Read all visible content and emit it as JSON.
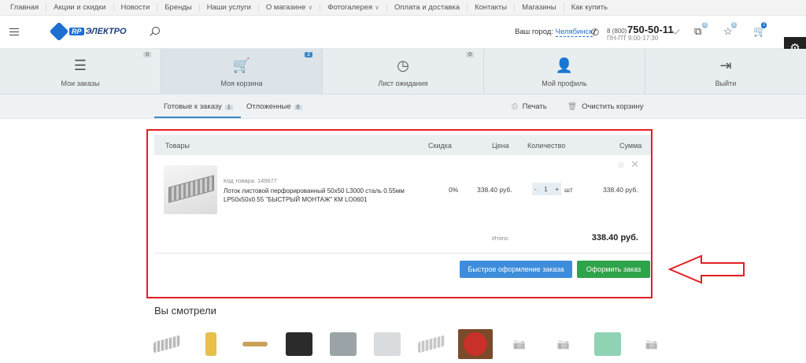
{
  "topnav": [
    {
      "label": "Главная",
      "arrow": false
    },
    {
      "label": "Акции и скидки",
      "arrow": false
    },
    {
      "label": "Новости",
      "arrow": false
    },
    {
      "label": "Бренды",
      "arrow": false
    },
    {
      "label": "Наши услуги",
      "arrow": false
    },
    {
      "label": "О магазине",
      "arrow": true
    },
    {
      "label": "Фотогалерея",
      "arrow": true
    },
    {
      "label": "Оплата и доставка",
      "arrow": false
    },
    {
      "label": "Контакты",
      "arrow": false
    },
    {
      "label": "Магазины",
      "arrow": false
    },
    {
      "label": "Как купить",
      "arrow": false
    }
  ],
  "header": {
    "logo_rp": "RP",
    "logo_text": "ЭЛЕКТРО",
    "city_label": "Ваш город:",
    "city_value": "Челябинск",
    "phone_prefix": "8 (800)",
    "phone_number": "750-50-11",
    "phone_hours": "ПН-ПТ 9:00-17:30",
    "compare_count": "0",
    "favorites_count": "0",
    "cart_count": "2"
  },
  "tabs": [
    {
      "label": "Мои заказы",
      "count": "0",
      "icon": "list-icon",
      "glyph": "☰"
    },
    {
      "label": "Моя корзина",
      "count": "2",
      "icon": "cart-icon",
      "glyph": "🛒"
    },
    {
      "label": "Лист ожидания",
      "count": "0",
      "icon": "clock-icon",
      "glyph": "◷"
    },
    {
      "label": "Мой профиль",
      "count": "",
      "icon": "user-icon",
      "glyph": "👤"
    },
    {
      "label": "Выйти",
      "count": "",
      "icon": "logout-icon",
      "glyph": "⇥"
    }
  ],
  "subtabs": {
    "ready_label": "Готовые к заказу",
    "ready_count": "1",
    "postponed_label": "Отложенные",
    "postponed_count": "0",
    "print_label": "Печать",
    "clear_label": "Очистить корзину"
  },
  "cart": {
    "columns": {
      "goods": "Товары",
      "discount": "Скидка",
      "price": "Цена",
      "quantity": "Количество",
      "sum": "Сумма"
    },
    "item": {
      "code": "Код товара: 149677",
      "name": "Лоток листовой перфорированный 50х50 L3000 сталь 0.55мм LP50x50x0.55 \"БЫСТРЫЙ МОНТАЖ\" КМ LO0601",
      "discount": "0%",
      "price": "338.40 руб.",
      "qty_minus": "-",
      "qty": "1",
      "qty_plus": "+",
      "unit": "шт",
      "sum": "338.40 руб."
    },
    "total_label": "Итого:",
    "total_value": "338.40 руб.",
    "quick_order_label": "Быстрое оформление заказа",
    "checkout_label": "Оформить заказ"
  },
  "seen": {
    "title": "Вы смотрели",
    "items": [
      {
        "kind": "tray",
        "color": "#b9b9b9"
      },
      {
        "kind": "bottle",
        "color": "#e7c04a"
      },
      {
        "kind": "pen",
        "color": "#c9a25a"
      },
      {
        "kind": "backpack",
        "color": "#2b2b2b"
      },
      {
        "kind": "box",
        "color": "#9aa3a8"
      },
      {
        "kind": "meter",
        "color": "#d8dcde"
      },
      {
        "kind": "tray",
        "color": "#c7c7c7"
      },
      {
        "kind": "santa",
        "color": "#c8302a"
      },
      {
        "kind": "camera",
        "color": "#ffffff"
      },
      {
        "kind": "camera",
        "color": "#ffffff"
      },
      {
        "kind": "pipe",
        "color": "#8fd3b4"
      },
      {
        "kind": "camera",
        "color": "#ffffff"
      }
    ]
  }
}
